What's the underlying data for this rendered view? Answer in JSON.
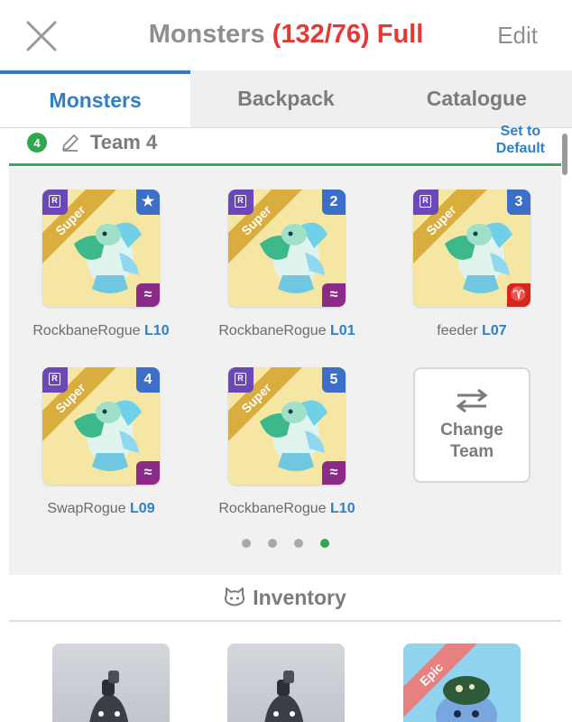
{
  "header": {
    "title": "Monsters",
    "count": "(132/76)",
    "status": "Full",
    "edit_label": "Edit",
    "close_icon": "close-icon"
  },
  "tabs": [
    {
      "label": "Monsters",
      "active": true
    },
    {
      "label": "Backpack",
      "active": false
    },
    {
      "label": "Catalogue",
      "active": false
    }
  ],
  "team": {
    "number": "4",
    "name": "Team 4",
    "set_default_line1": "Set to",
    "set_default_line2": "Default",
    "accent_color": "#3aa858"
  },
  "team_slots": [
    {
      "rarity": "Super",
      "badge": "★",
      "element": "≈",
      "element_color": "#8c2a8a",
      "name": "RockbaneRogue",
      "level": "L10"
    },
    {
      "rarity": "Super",
      "badge": "2",
      "element": "≈",
      "element_color": "#8c2a8a",
      "name": "RockbaneRogue",
      "level": "L01"
    },
    {
      "rarity": "Super",
      "badge": "3",
      "element": "♈",
      "element_color": "#d9251d",
      "name": "feeder",
      "level": "L07"
    },
    {
      "rarity": "Super",
      "badge": "4",
      "element": "≈",
      "element_color": "#8c2a8a",
      "name": "SwapRogue",
      "level": "L09"
    },
    {
      "rarity": "Super",
      "badge": "5",
      "element": "≈",
      "element_color": "#8c2a8a",
      "name": "RockbaneRogue",
      "level": "L10"
    }
  ],
  "change_team": {
    "line1": "Change",
    "line2": "Team",
    "icon": "swap-arrows-icon"
  },
  "pagination": {
    "pages": 4,
    "active_page": 4
  },
  "inventory": {
    "title": "Inventory",
    "icon": "cat-face-icon",
    "items": [
      {
        "rarity": "",
        "style": "gray"
      },
      {
        "rarity": "",
        "style": "gray"
      },
      {
        "rarity": "Epic",
        "style": "epic"
      }
    ]
  }
}
